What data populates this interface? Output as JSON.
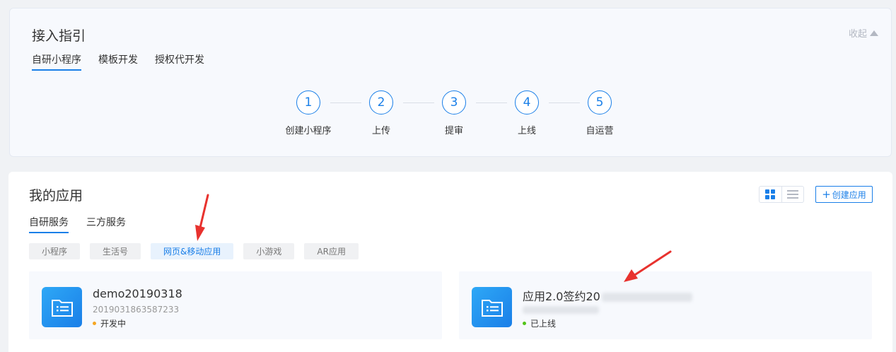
{
  "guide": {
    "title": "接入指引",
    "collapse_label": "收起",
    "tabs": [
      "自研小程序",
      "模板开发",
      "授权代开发"
    ],
    "steps": [
      {
        "num": "1",
        "label": "创建小程序"
      },
      {
        "num": "2",
        "label": "上传"
      },
      {
        "num": "3",
        "label": "提审"
      },
      {
        "num": "4",
        "label": "上线"
      },
      {
        "num": "5",
        "label": "自运营"
      }
    ]
  },
  "apps": {
    "title": "我的应用",
    "create_label": "创建应用",
    "tabs": [
      "自研服务",
      "三方服务"
    ],
    "filters": [
      "小程序",
      "生活号",
      "网页&移动应用",
      "小游戏",
      "AR应用"
    ],
    "active_filter": "网页&移动应用",
    "cards": [
      {
        "name": "demo20190318",
        "id": "2019031863587233",
        "status": "开发中",
        "status_color": "#f5a623"
      },
      {
        "name": "应用2.0签约20",
        "id": "",
        "status": "已上线",
        "status_color": "#52c41a"
      }
    ]
  },
  "colors": {
    "accent": "#1a7fe8",
    "annotation_arrow": "#e8322e"
  }
}
